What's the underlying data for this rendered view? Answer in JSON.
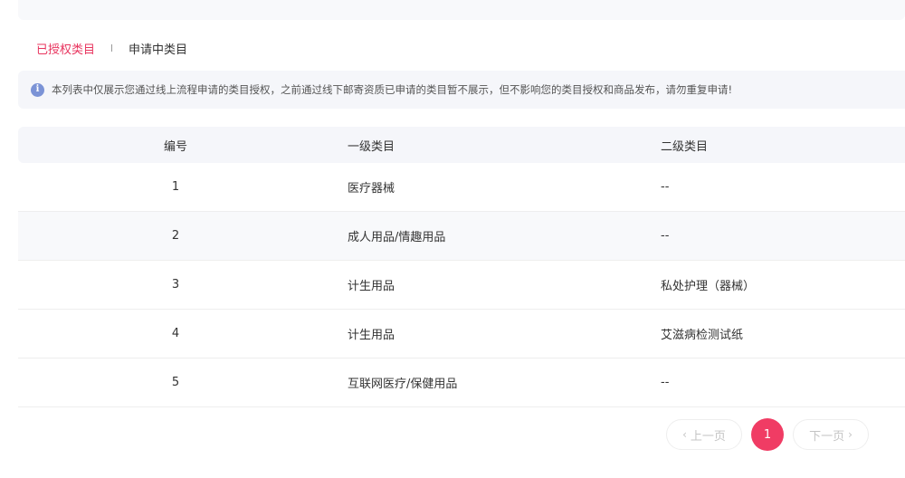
{
  "tabs": [
    {
      "label": "已授权类目",
      "active": true
    },
    {
      "label": "申请中类目",
      "active": false
    }
  ],
  "notice": {
    "icon": "info-icon",
    "text": "本列表中仅展示您通过线上流程申请的类目授权，之前通过线下邮寄资质已申请的类目暂不展示，但不影响您的类目授权和商品发布，请勿重复申请!"
  },
  "table": {
    "headers": {
      "number": "编号",
      "level1": "一级类目",
      "level2": "二级类目"
    },
    "rows": [
      {
        "number": "1",
        "level1": "医疗器械",
        "level2": "--"
      },
      {
        "number": "2",
        "level1": "成人用品/情趣用品",
        "level2": "--"
      },
      {
        "number": "3",
        "level1": "计生用品",
        "level2": "私处护理（器械）"
      },
      {
        "number": "4",
        "level1": "计生用品",
        "level2": "艾滋病检测试纸"
      },
      {
        "number": "5",
        "level1": "互联网医疗/保健用品",
        "level2": "--"
      }
    ]
  },
  "pagination": {
    "prev_label": "上一页",
    "current_page": "1",
    "next_label": "下一页"
  },
  "colors": {
    "accent": "#f03c64",
    "active_tab": "#e8345e",
    "info_icon": "#7b93d6"
  }
}
